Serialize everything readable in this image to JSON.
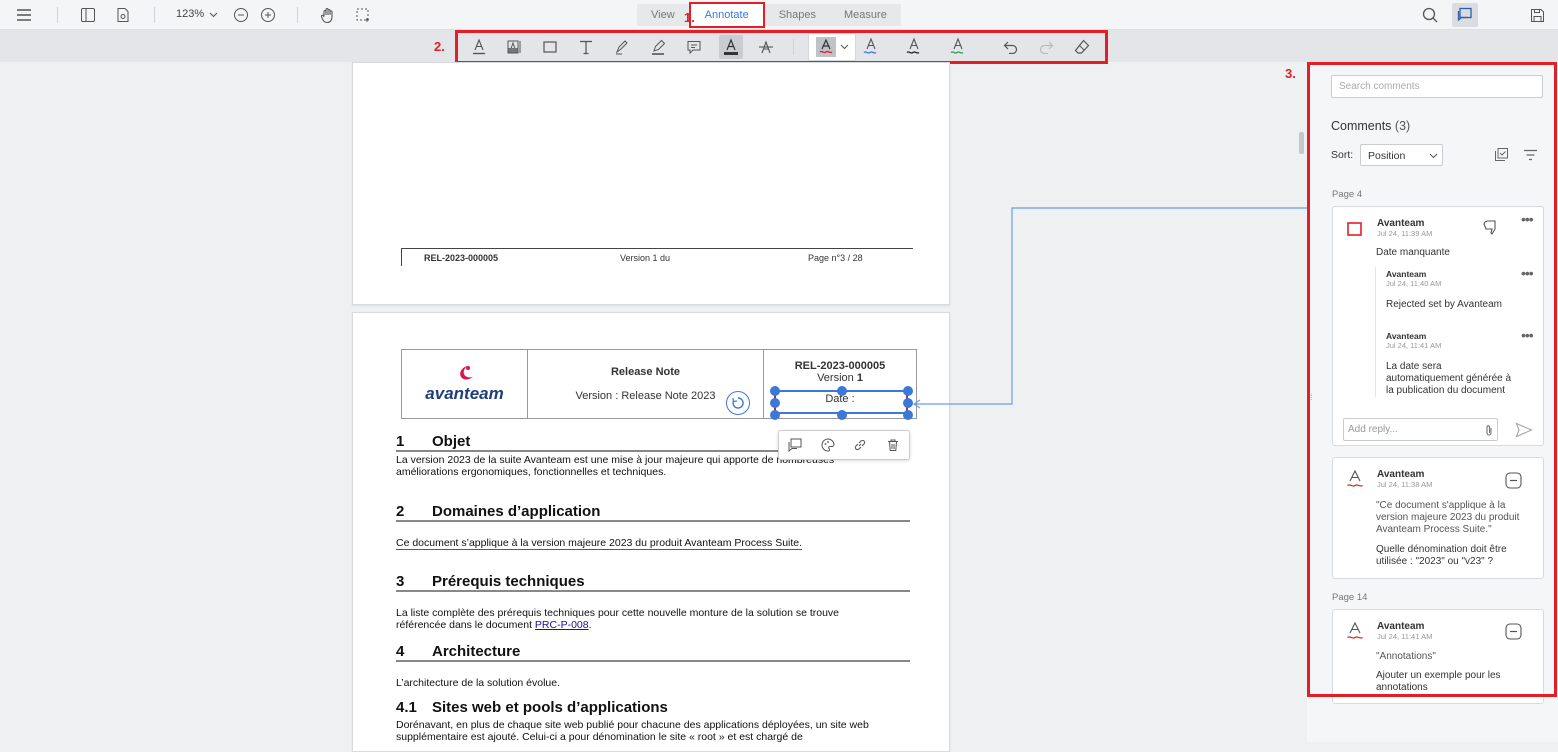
{
  "topbar": {
    "zoom": "123%",
    "tabs": [
      {
        "label": "View"
      },
      {
        "label": "Annotate"
      },
      {
        "label": "Shapes"
      },
      {
        "label": "Measure"
      }
    ]
  },
  "markers": {
    "m1": "1.",
    "m2": "2.",
    "m3": "3."
  },
  "page3": {
    "footer_ref": "REL-2023-000005",
    "footer_version": "Version 1 du",
    "footer_page": "Page n°3 / 28"
  },
  "page4": {
    "logo": "avanteam",
    "header_title": "Release Note",
    "header_version": "Version : Release Note 2023",
    "header_ref": "REL-2023-000005",
    "header_ref_version_prefix": "Version ",
    "header_ref_version_num": "1",
    "header_date": "Date :",
    "sections": [
      {
        "num": "1",
        "title": "Objet"
      },
      {
        "num": "2",
        "title": "Domaines d’application"
      },
      {
        "num": "3",
        "title": "Prérequis techniques"
      },
      {
        "num": "4",
        "title": "Architecture"
      },
      {
        "num": "4.1",
        "title": "Sites web et pools d’applications"
      }
    ],
    "p1a": "La version 2023 de la suite Avanteam est une mise à jour majeure qui apporte de nombreuses",
    "p1b": "améliorations ergonomiques, fonctionnelles et techniques.",
    "p2": "Ce document s’applique à la version majeure 2023 du produit Avanteam Process Suite.",
    "p3a": "La liste complète des prérequis techniques pour cette nouvelle monture de la solution se trouve",
    "p3b": "référencée dans le document ",
    "p3link": "PRC-P-008",
    "p3c": ".",
    "p4": "L’architecture de la solution évolue.",
    "p5a": "Dorénavant, en plus de chaque site web publié pour chacune des applications déployées, un site web",
    "p5b": "supplémentaire est ajouté. Celui-ci a pour dénomination le site « root » et est chargé de"
  },
  "sidebar": {
    "search_placeholder": "Search comments",
    "comments_label": "Comments",
    "comments_count": "(3)",
    "sort_label": "Sort:",
    "sort_value": "Position",
    "page_labels": [
      "Page 4",
      "Page 14"
    ],
    "comments": [
      {
        "author": "Avanteam",
        "date": "Jul 24, 11:39 AM",
        "text": "Date manquante",
        "replies": [
          {
            "author": "Avanteam",
            "date": "Jul 24, 11:40 AM",
            "text": "Rejected set by Avanteam"
          },
          {
            "author": "Avanteam",
            "date": "Jul 24, 11:41 AM",
            "text_lines": [
              "La date sera",
              "automatiquement générée à",
              "la publication du document"
            ]
          }
        ],
        "reply_placeholder": "Add reply..."
      },
      {
        "author": "Avanteam",
        "date": "Jul 24, 11:38 AM",
        "quote_lines": [
          "\"Ce document s'applique à la",
          "version majeure 2023 du produit",
          "Avanteam Process Suite.\""
        ],
        "text_lines": [
          "Quelle dénomination doit être",
          "utilisée : \"2023\" ou \"v23\" ?"
        ]
      },
      {
        "author": "Avanteam",
        "date": "Jul 24, 11:41 AM",
        "quote": "\"Annotations\"",
        "text_lines": [
          "Ajouter un exemple pour les",
          "annotations"
        ]
      }
    ]
  },
  "colors": {
    "accent": "#3b78d8",
    "marker": "#e41e26"
  }
}
